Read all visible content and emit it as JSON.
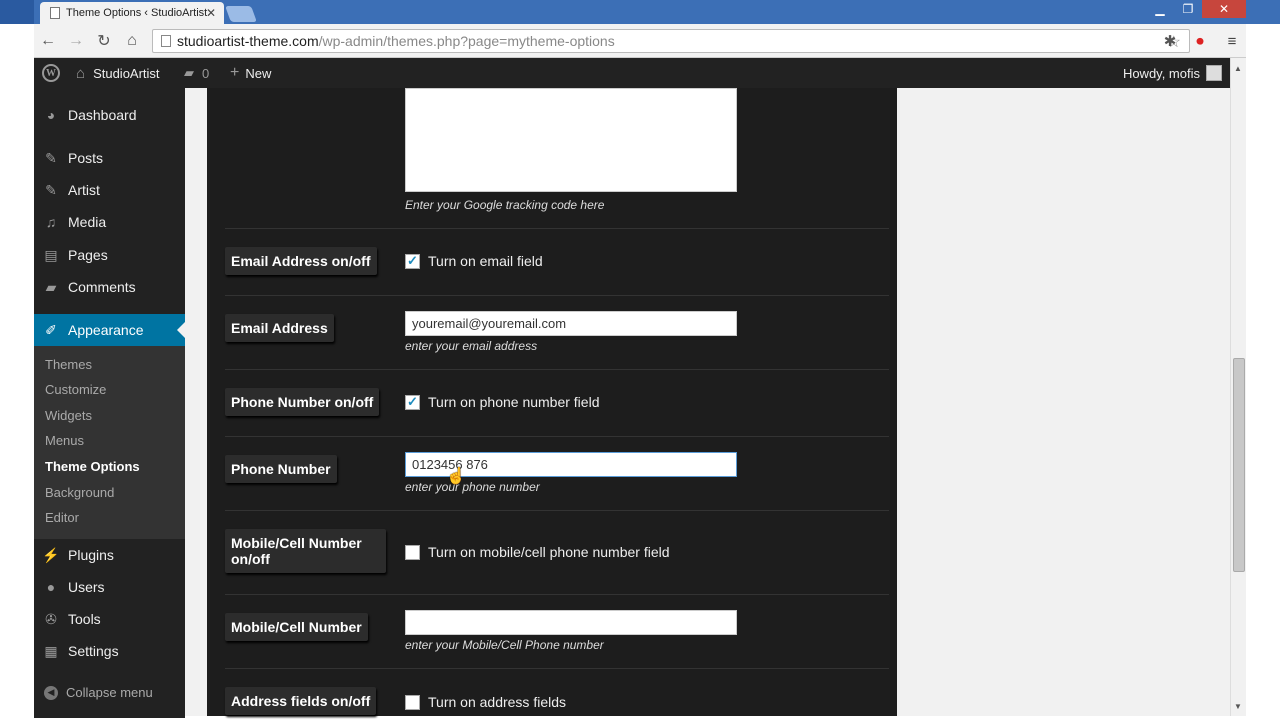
{
  "browser": {
    "tab_title": "Theme Options ‹ StudioArtist",
    "url_host": "studioartist-theme.com",
    "url_path": "/wp-admin/themes.php?page=mytheme-options"
  },
  "adminbar": {
    "site_name": "StudioArtist",
    "comments_count": "0",
    "new_label": "New",
    "howdy": "Howdy, mofis"
  },
  "sidebar": {
    "items": [
      {
        "label": "Dashboard",
        "icon": "dashboard-icon"
      },
      {
        "label": "Posts",
        "icon": "pin-icon"
      },
      {
        "label": "Artist",
        "icon": "pin-icon"
      },
      {
        "label": "Media",
        "icon": "media-icon"
      },
      {
        "label": "Pages",
        "icon": "pages-icon"
      },
      {
        "label": "Comments",
        "icon": "comment-icon"
      },
      {
        "label": "Appearance",
        "icon": "brush-icon"
      },
      {
        "label": "Plugins",
        "icon": "plug-icon"
      },
      {
        "label": "Users",
        "icon": "user-icon"
      },
      {
        "label": "Tools",
        "icon": "wrench-icon"
      },
      {
        "label": "Settings",
        "icon": "settings-icon"
      }
    ],
    "submenu": [
      "Themes",
      "Customize",
      "Widgets",
      "Menus",
      "Theme Options",
      "Background",
      "Editor"
    ],
    "current_submenu": "Theme Options",
    "collapse_label": "Collapse menu"
  },
  "form": {
    "tracking_hint": "Enter your Google tracking code here",
    "email_toggle": {
      "label": "Email Address on/off",
      "checkbox_label": "Turn on email field",
      "checked": true
    },
    "email": {
      "label": "Email Address",
      "value": "youremail@youremail.com",
      "hint": "enter your email address"
    },
    "phone_toggle": {
      "label": "Phone Number on/off",
      "checkbox_label": "Turn on phone number field",
      "checked": true
    },
    "phone": {
      "label": "Phone Number",
      "value": "0123456 876",
      "hint": "enter your phone number"
    },
    "mobile_toggle": {
      "label_line1": "Mobile/Cell Number",
      "label_line2": "on/off",
      "checkbox_label": "Turn on mobile/cell phone number field",
      "checked": false
    },
    "mobile": {
      "label": "Mobile/Cell Number",
      "value": "",
      "hint": "enter your Mobile/Cell Phone number"
    },
    "address_toggle": {
      "label": "Address fields on/off",
      "checkbox_label": "Turn on address fields",
      "checked": false
    }
  },
  "colors": {
    "admin_bar": "#222222",
    "active_menu": "#0074a2",
    "panel": "#1d1d1d"
  }
}
